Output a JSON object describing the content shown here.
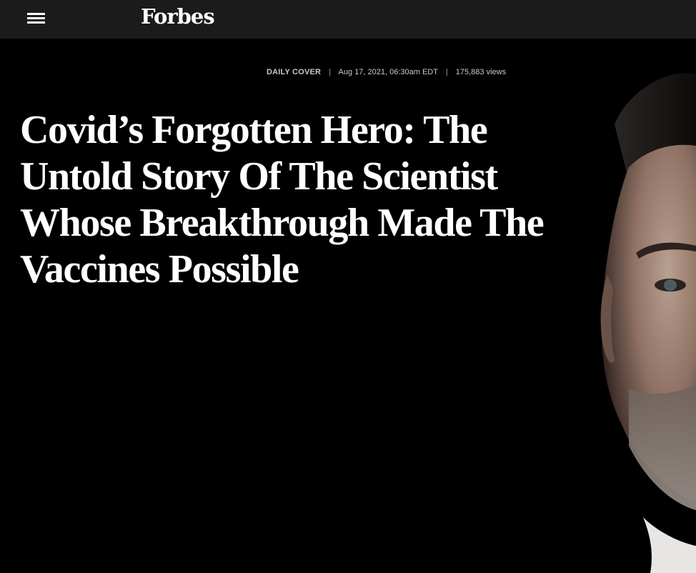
{
  "header": {
    "menu_icon": "hamburger-menu-icon",
    "logo_text": "Forbes"
  },
  "article": {
    "category": "DAILY COVER",
    "separator": "|",
    "date": "Aug 17, 2021, 06:30am EDT",
    "views": "175,883 views",
    "title": "Covid’s Forgotten Hero: The Untold Story Of The Scientist Whose Breakthrough Made The Vaccines Possible"
  },
  "colors": {
    "topbar": "#1b1b1b",
    "hero_background": "#000000",
    "headline": "#ffffff",
    "meta_text": "#c9c9c9"
  }
}
